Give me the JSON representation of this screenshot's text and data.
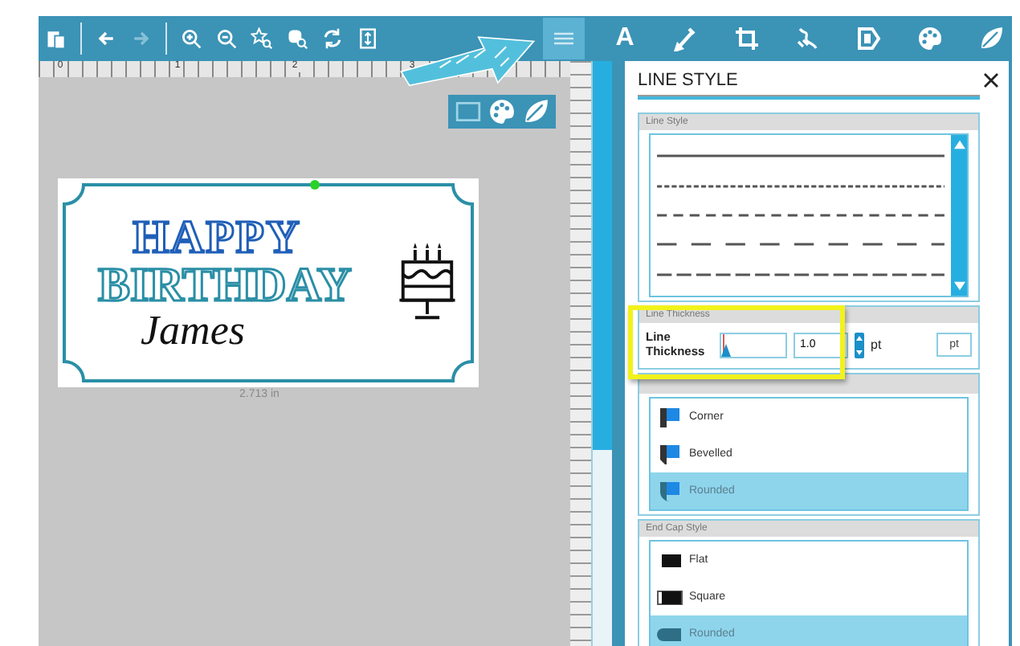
{
  "toolbar": {
    "left_tools": [
      {
        "disabled": false
      },
      {
        "disabled": false
      },
      {
        "disabled": true
      },
      {
        "disabled": false
      },
      {
        "disabled": false
      },
      {
        "disabled": false
      },
      {
        "disabled": false
      },
      {
        "disabled": false
      },
      {
        "disabled": false
      }
    ],
    "panel_tools": [
      {
        "selected": true
      },
      {
        "label": "A",
        "selected": false
      },
      {
        "selected": false
      },
      {
        "selected": false
      },
      {
        "selected": false
      },
      {
        "selected": false
      },
      {
        "selected": false
      },
      {
        "selected": false
      }
    ]
  },
  "ruler": {
    "labels": [
      "0",
      "1",
      "2",
      "3"
    ]
  },
  "canvas": {
    "mini_tools": [
      {
        "selected": true
      },
      {
        "selected": false
      },
      {
        "selected": false
      }
    ],
    "design": {
      "line_1": "HAPPY",
      "line_2": "BIRTHDAY",
      "name": "James"
    },
    "dimension": "2.713 in"
  },
  "panel": {
    "title": "LINE STYLE",
    "line_style": {
      "heading": "Line Style",
      "styles": [
        {
          "kind": "solid"
        },
        {
          "kind": "fine"
        },
        {
          "kind": "dash"
        },
        {
          "kind": "long"
        },
        {
          "kind": "medium"
        }
      ]
    },
    "thickness": {
      "heading": "Line Thickness",
      "label": "Line Thickness",
      "level": 0.02,
      "value": "1.0",
      "unit": "pt",
      "unit_button": "pt"
    },
    "corner_styles": [
      {
        "kind": "corner",
        "label": "Corner",
        "selected": false
      },
      {
        "kind": "bevel",
        "label": "Bevelled",
        "selected": false
      },
      {
        "kind": "round",
        "label": "Rounded",
        "selected": true
      }
    ],
    "end_cap": {
      "heading": "End Cap Style",
      "items": [
        {
          "kind": "flat",
          "label": "Flat",
          "selected": false
        },
        {
          "kind": "square",
          "label": "Square",
          "selected": false
        },
        {
          "kind": "round",
          "label": "Rounded",
          "selected": true
        }
      ]
    }
  }
}
